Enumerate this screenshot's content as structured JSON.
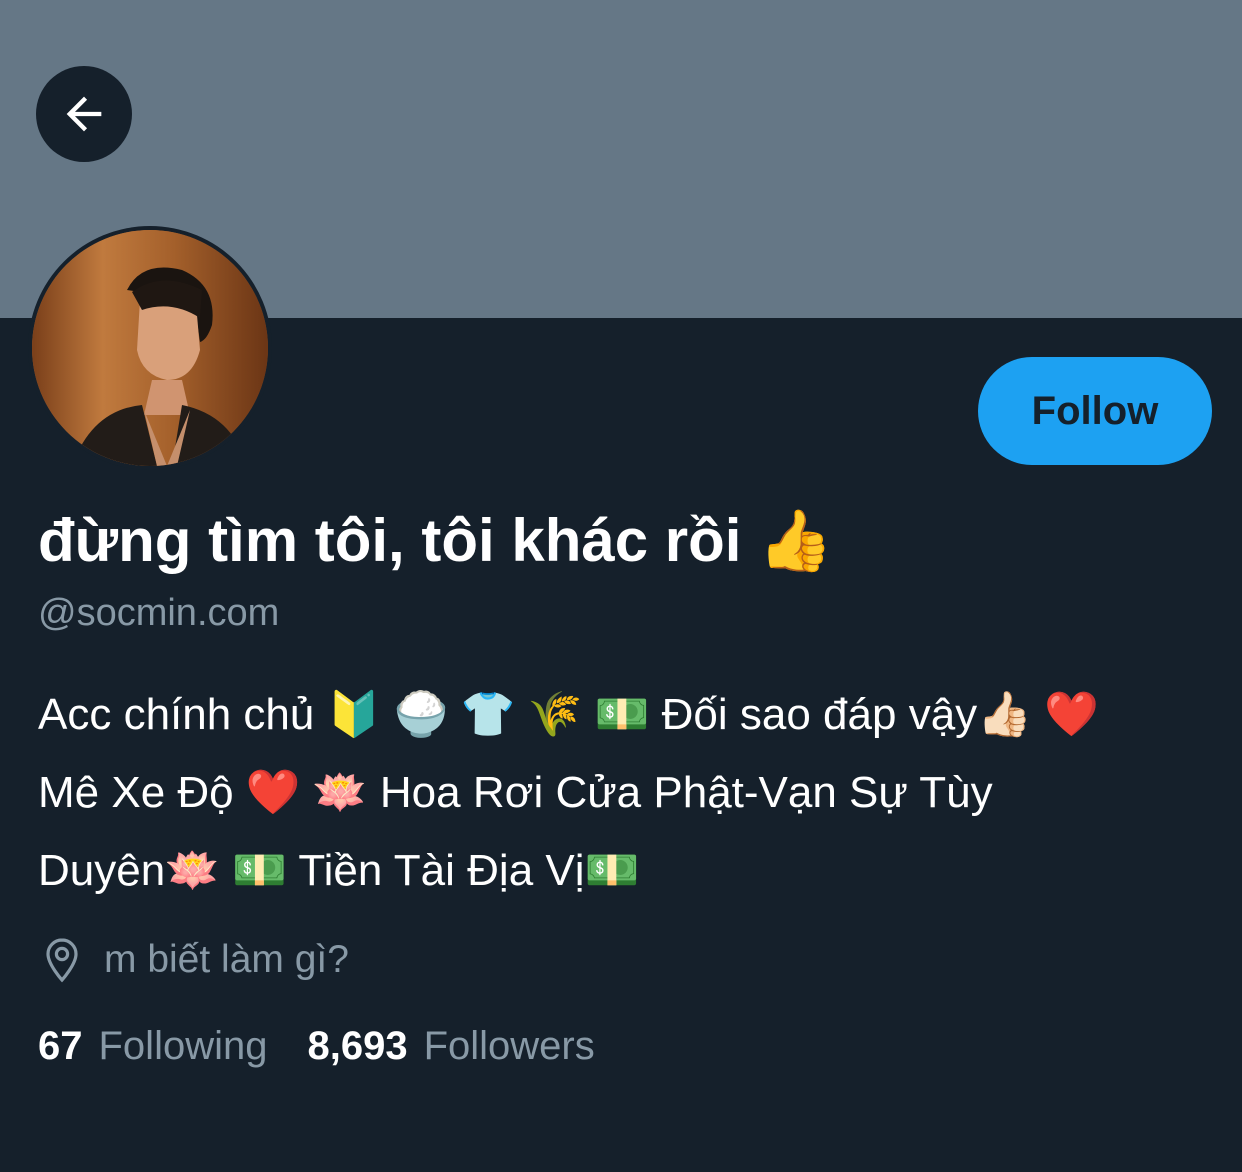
{
  "profile": {
    "display_name": "đừng tìm tôi, tôi khác rồi 👍",
    "handle": "@socmin.com",
    "bio_lines": [
      "Acc chính chủ 🔰 🍚 👕 🌾 💵 Đối sao đáp vậy👍🏻 ❤️",
      "Mê Xe Độ ❤️ 🪷 Hoa Rơi Cửa Phật-Vạn Sự Tùy",
      "Duyên🪷 💵 Tiền Tài Địa Vị💵"
    ],
    "location": "m biết làm gì?",
    "follow_label": "Follow"
  },
  "stats": {
    "following_count": "67",
    "following_label": "Following",
    "followers_count": "8,693",
    "followers_label": "Followers"
  },
  "icons": {
    "back": "back-arrow-icon",
    "location": "location-pin-icon"
  },
  "colors": {
    "background": "#15202b",
    "banner": "#657786",
    "accent": "#1da1f2",
    "secondary_text": "#8899a6",
    "primary_text": "#ffffff"
  }
}
